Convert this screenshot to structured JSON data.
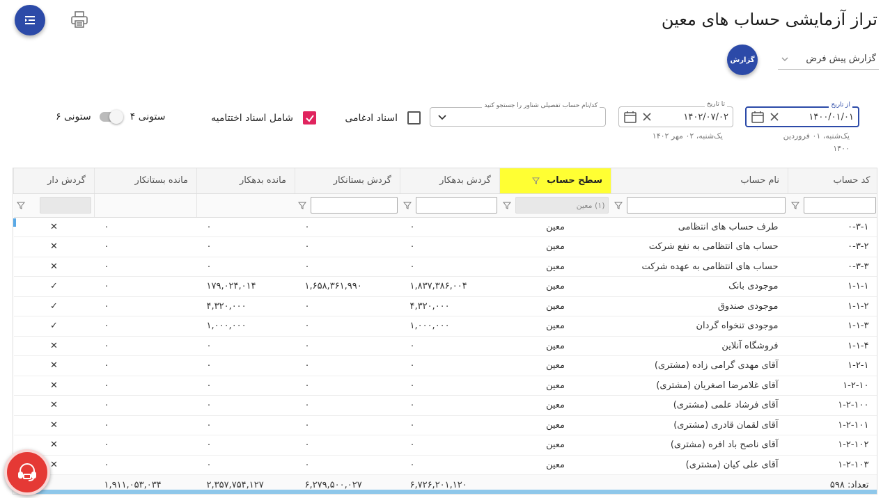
{
  "title": "تراز آزمایشی حساب های معین",
  "report": {
    "selected": "گزارش پیش فرض",
    "button_label": "گزارش"
  },
  "from_date": {
    "label": "از تاریخ",
    "value": "۱۴۰۰/۰۱/۰۱",
    "hint": "یک‌شنبه، ۰۱ فروردین ۱۴۰۰"
  },
  "to_date": {
    "label": "تا تاریخ",
    "value": "۱۴۰۲/۰۷/۰۲",
    "hint": "یک‌شنبه، ۰۲ مهر ۱۴۰۲"
  },
  "account_search": {
    "label": "کد/نام حساب تفصیلی شناور را جستجو کنید",
    "value": ""
  },
  "options": {
    "merged_docs": {
      "label": "اسناد ادغامی",
      "checked": false
    },
    "closing_docs": {
      "label": "شامل اسناد اختتامیه",
      "checked": true
    },
    "four_col": "۴ ستونی",
    "six_col": "۶ ستونی"
  },
  "table": {
    "columns": [
      "کد حساب",
      "نام حساب",
      "سطح حساب",
      "گردش بدهکار",
      "گردش بستانکار",
      "مانده بدهکار",
      "مانده بستانکار",
      "گردش دار"
    ],
    "level_filter": "(۱) معین",
    "rows": [
      [
        "۰-۳-۱",
        "طرف حساب های انتظامی",
        "معین",
        "۰",
        "۰",
        "۰",
        "۰",
        "✕"
      ],
      [
        "۰-۳-۲",
        "حساب های انتظامی به نفع شرکت",
        "معین",
        "۰",
        "۰",
        "۰",
        "۰",
        "✕"
      ],
      [
        "۰-۳-۳",
        "حساب های انتظامی به عهده شرکت",
        "معین",
        "۰",
        "۰",
        "۰",
        "۰",
        "✕"
      ],
      [
        "۱-۱-۱",
        "موجودی بانک",
        "معین",
        "۱,۸۳۷,۳۸۶,۰۰۴",
        "۱,۶۵۸,۳۶۱,۹۹۰",
        "۱۷۹,۰۲۴,۰۱۴",
        "۰",
        "✓"
      ],
      [
        "۱-۱-۲",
        "موجودی صندوق",
        "معین",
        "۴,۳۲۰,۰۰۰",
        "۰",
        "۴,۳۲۰,۰۰۰",
        "۰",
        "✓"
      ],
      [
        "۱-۱-۳",
        "موجودی تنخواه گردان",
        "معین",
        "۱,۰۰۰,۰۰۰",
        "۰",
        "۱,۰۰۰,۰۰۰",
        "۰",
        "✓"
      ],
      [
        "۱-۱-۴",
        "فروشگاه آنلاین",
        "معین",
        "۰",
        "۰",
        "۰",
        "۰",
        "✕"
      ],
      [
        "۱-۲-۱",
        "آقای مهدی گرامی زاده (مشتری)",
        "معین",
        "۰",
        "۰",
        "۰",
        "۰",
        "✕"
      ],
      [
        "۱-۲-۱۰",
        "آقای غلامرضا اصغریان (مشتری)",
        "معین",
        "۰",
        "۰",
        "۰",
        "۰",
        "✕"
      ],
      [
        "۱-۲-۱۰۰",
        "آقای فرشاد علمی (مشتری)",
        "معین",
        "۰",
        "۰",
        "۰",
        "۰",
        "✕"
      ],
      [
        "۱-۲-۱۰۱",
        "آقای لقمان قادری (مشتری)",
        "معین",
        "۰",
        "۰",
        "۰",
        "۰",
        "✕"
      ],
      [
        "۱-۲-۱۰۲",
        "آقای ناصح باد افره (مشتری)",
        "معین",
        "۰",
        "۰",
        "۰",
        "۰",
        "✕"
      ],
      [
        "۱-۲-۱۰۳",
        "آقای علی کیان (مشتری)",
        "معین",
        "۰",
        "۰",
        "۰",
        "۰",
        "✕"
      ]
    ],
    "footer": {
      "count": "تعداد: ۵۹۸",
      "debit_turnover": "۶,۷۲۶,۲۰۱,۱۲۰",
      "credit_turnover": "۶,۲۷۹,۵۰۰,۰۲۷",
      "debit_balance": "۲,۳۵۷,۷۵۴,۱۲۷",
      "credit_balance": "۱,۹۱۱,۰۵۳,۰۳۴"
    }
  },
  "colors": {
    "primary": "#2c4aa8",
    "accent_check": "#e0245e",
    "highlight_col": "#ffff33",
    "support": "#e53935"
  }
}
